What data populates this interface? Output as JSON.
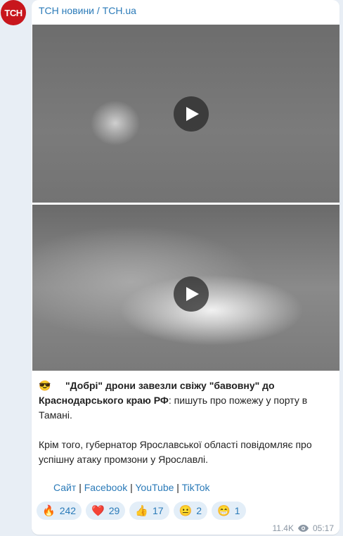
{
  "channel": {
    "avatar_text": "TCH",
    "name": "ТСН новини / TCH.ua"
  },
  "post": {
    "emoji": "😎",
    "headline_bold": "\"Добрі\" дрони завезли свіжу \"бавовну\" до Краснодарського краю РФ",
    "headline_rest": ": пишуть про пожежу у порту в Тамані.",
    "paragraph2": "Крім того, губернатор Ярославської області повідомляє про успішну атаку промзони у Ярославлі.",
    "links": [
      "Сайт",
      "Facebook",
      "YouTube",
      "TikTok"
    ],
    "separator": "|"
  },
  "reactions": [
    {
      "emoji": "🔥",
      "count": "242"
    },
    {
      "emoji": "❤️",
      "count": "29"
    },
    {
      "emoji": "👍",
      "count": "17"
    },
    {
      "emoji": "😐",
      "count": "2"
    },
    {
      "emoji": "😁",
      "count": "1"
    }
  ],
  "meta": {
    "views": "11.4K",
    "time": "05:17"
  }
}
